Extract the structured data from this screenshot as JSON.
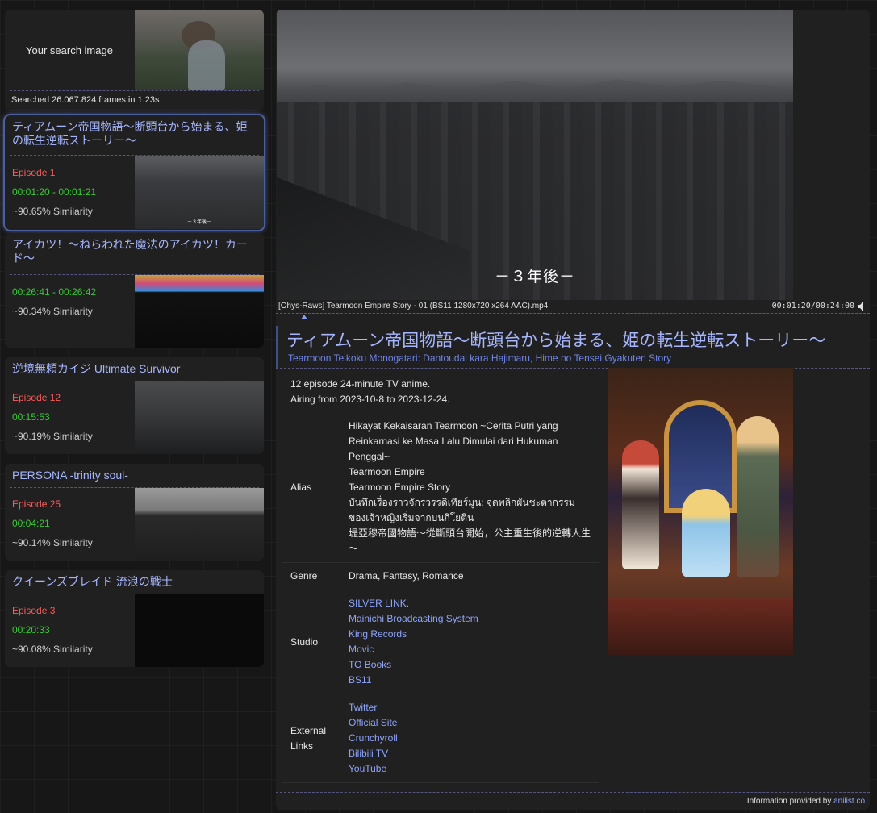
{
  "search": {
    "label": "Your search image",
    "stats": "Searched 26.067.824 frames in 1.23s"
  },
  "results": [
    {
      "title": "ティアムーン帝国物語～断頭台から始まる、姫の転生逆転ストーリー～",
      "episode": "Episode 1",
      "time": "00:01:20 - 00:01:21",
      "similarity": "~90.65% Similarity",
      "active": true
    },
    {
      "title": "アイカツ！～ねらわれた魔法のアイカツ！カード～",
      "episode": "",
      "time": "00:26:41 - 00:26:42",
      "similarity": "~90.34% Similarity"
    },
    {
      "title": "逆境無頼カイジ Ultimate Survivor",
      "episode": "Episode 12",
      "time": "00:15:53",
      "similarity": "~90.19% Similarity"
    },
    {
      "title": "PERSONA -trinity soul-",
      "episode": "Episode 25",
      "time": "00:04:21",
      "similarity": "~90.14% Similarity"
    },
    {
      "title": "クイーンズブレイド 流浪の戦士",
      "episode": "Episode 3",
      "time": "00:20:33",
      "similarity": "~90.08% Similarity"
    }
  ],
  "player": {
    "subtitle": "－３年後－",
    "thumb_caption": "－３年後－",
    "filename": "[Ohys-Raws] Tearmoon Empire Story - 01 (BS11 1280x720 x264 AAC).mp4",
    "timecode": "00:01:20/00:24:00"
  },
  "anime": {
    "title_jp": "ティアムーン帝国物語～断頭台から始まる、姫の転生逆転ストーリー～",
    "title_romaji": "Tearmoon Teikoku Monogatari: Dantoudai kara Hajimaru, Hime no Tensei Gyakuten Story",
    "summary_line1": "12 episode 24-minute TV anime.",
    "summary_line2": "Airing from 2023-10-8 to 2023-12-24.",
    "labels": {
      "alias": "Alias",
      "genre": "Genre",
      "studio": "Studio",
      "external": "External Links"
    },
    "aliases": [
      "Hikayat Kekaisaran Tearmoon ~Cerita Putri yang Reinkarnasi ke Masa Lalu Dimulai dari Hukuman Penggal~",
      "Tearmoon Empire",
      "Tearmoon Empire Story",
      "บันทึกเรื่องราวจักรวรรดิเทียร์มูน: จุดพลิกผันชะตากรรมของเจ้าหญิงเริ่มจากบนกิโยติน",
      "堤亞穆帝國物語～從斷頭台開始，公主重生後的逆轉人生～"
    ],
    "genre": "Drama, Fantasy, Romance",
    "studios": [
      "SILVER LINK.",
      "Mainichi Broadcasting System",
      "King Records",
      "Movic",
      "TO Books",
      "BS11"
    ],
    "links": [
      "Twitter",
      "Official Site",
      "Crunchyroll",
      "Bilibili TV",
      "YouTube"
    ]
  },
  "credit": {
    "text": "Information provided by ",
    "link": "anilist.co"
  }
}
